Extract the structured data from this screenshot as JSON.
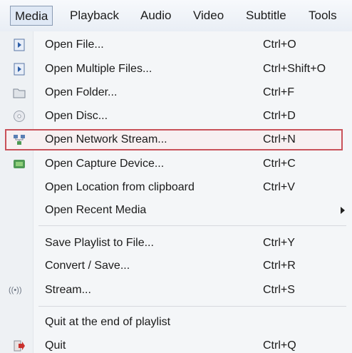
{
  "menubar": {
    "items": [
      {
        "label": "Media"
      },
      {
        "label": "Playback"
      },
      {
        "label": "Audio"
      },
      {
        "label": "Video"
      },
      {
        "label": "Subtitle"
      },
      {
        "label": "Tools"
      }
    ]
  },
  "menu": {
    "items": [
      {
        "label": "Open File...",
        "shortcut": "Ctrl+O",
        "icon": "file-play-icon"
      },
      {
        "label": "Open Multiple Files...",
        "shortcut": "Ctrl+Shift+O",
        "icon": "files-play-icon"
      },
      {
        "label": "Open Folder...",
        "shortcut": "Ctrl+F",
        "icon": "folder-icon"
      },
      {
        "label": "Open Disc...",
        "shortcut": "Ctrl+D",
        "icon": "disc-icon"
      },
      {
        "label": "Open Network Stream...",
        "shortcut": "Ctrl+N",
        "icon": "network-icon"
      },
      {
        "label": "Open Capture Device...",
        "shortcut": "Ctrl+C",
        "icon": "capture-device-icon"
      },
      {
        "label": "Open Location from clipboard",
        "shortcut": "Ctrl+V",
        "icon": ""
      },
      {
        "label": "Open Recent Media",
        "shortcut": "",
        "icon": ""
      },
      {
        "label": "Save Playlist to File...",
        "shortcut": "Ctrl+Y",
        "icon": ""
      },
      {
        "label": "Convert / Save...",
        "shortcut": "Ctrl+R",
        "icon": ""
      },
      {
        "label": "Stream...",
        "shortcut": "Ctrl+S",
        "icon": "stream-icon"
      },
      {
        "label": "Quit at the end of playlist",
        "shortcut": "",
        "icon": ""
      },
      {
        "label": "Quit",
        "shortcut": "Ctrl+Q",
        "icon": "quit-icon"
      }
    ],
    "highlight_color": "#c9525a",
    "stream_icon_text": "((•))"
  }
}
